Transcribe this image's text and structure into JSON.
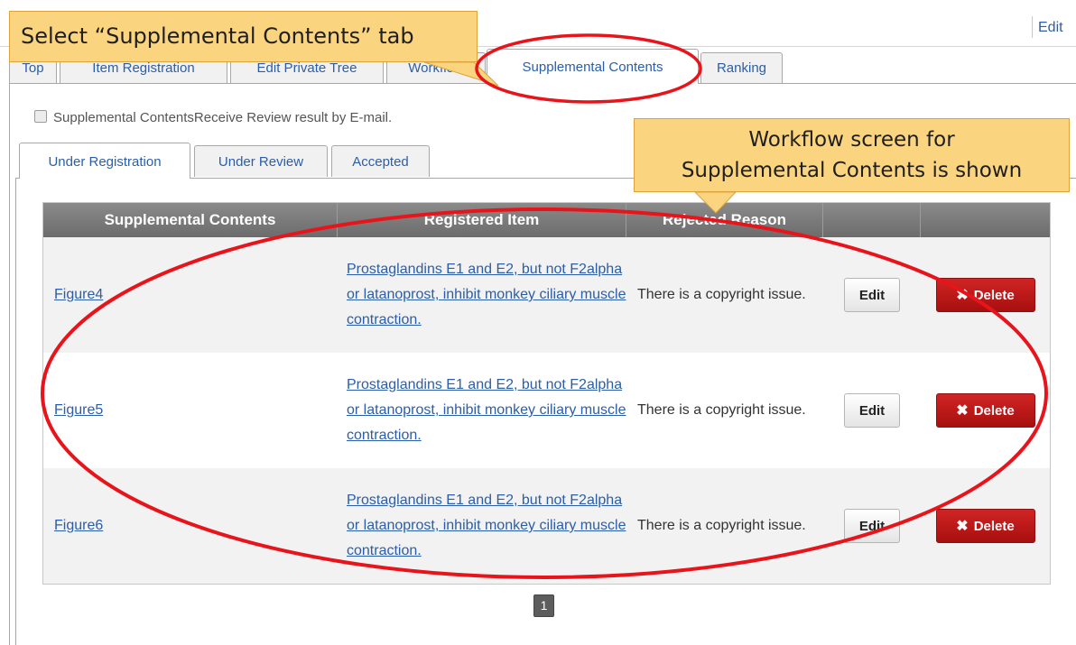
{
  "topbar": {
    "edit_link": "Edit"
  },
  "main_tabs": [
    {
      "label": "Top"
    },
    {
      "label": "Item Registration"
    },
    {
      "label": "Edit Private Tree"
    },
    {
      "label": "Workflow"
    },
    {
      "label": "Supplemental Contents",
      "active": true
    },
    {
      "label": "Ranking"
    }
  ],
  "notify_checkbox": {
    "label": "Supplemental ContentsReceive Review result by E-mail.",
    "checked": false
  },
  "sub_tabs": [
    {
      "label": "Under Registration",
      "active": true
    },
    {
      "label": "Under Review"
    },
    {
      "label": "Accepted"
    }
  ],
  "table": {
    "headers": [
      "Supplemental Contents",
      "Registered Item",
      "Rejected Reason",
      "",
      ""
    ],
    "rows": [
      {
        "content": "Figure4",
        "item": "Prostaglandins E1 and E2, but not F2alpha or latanoprost, inhibit monkey ciliary muscle contraction.",
        "reason": "There is a copyright issue.",
        "edit_label": "Edit",
        "delete_label": "Delete"
      },
      {
        "content": "Figure5",
        "item": "Prostaglandins E1 and E2, but not F2alpha or latanoprost, inhibit monkey ciliary muscle contraction.",
        "reason": "There is a copyright issue.",
        "edit_label": "Edit",
        "delete_label": "Delete"
      },
      {
        "content": "Figure6",
        "item": "Prostaglandins E1 and E2, but not F2alpha or latanoprost, inhibit monkey ciliary muscle contraction.",
        "reason": "There is a copyright issue.",
        "edit_label": "Edit",
        "delete_label": "Delete"
      }
    ]
  },
  "pagination": {
    "current_page": "1"
  },
  "annotations": {
    "callout_tab": "Select “Supplemental Contents” tab",
    "callout_workflow_line1": "Workflow screen for",
    "callout_workflow_line2": "Supplemental Contents is shown"
  },
  "colors": {
    "link": "#2b5ea8",
    "callout_fill": "#fbd480",
    "highlight_ellipse": "#e8141b",
    "delete_button": "#c01818",
    "header_bar": "#7a7a7a"
  },
  "icons": {
    "delete": "close-x-icon"
  }
}
